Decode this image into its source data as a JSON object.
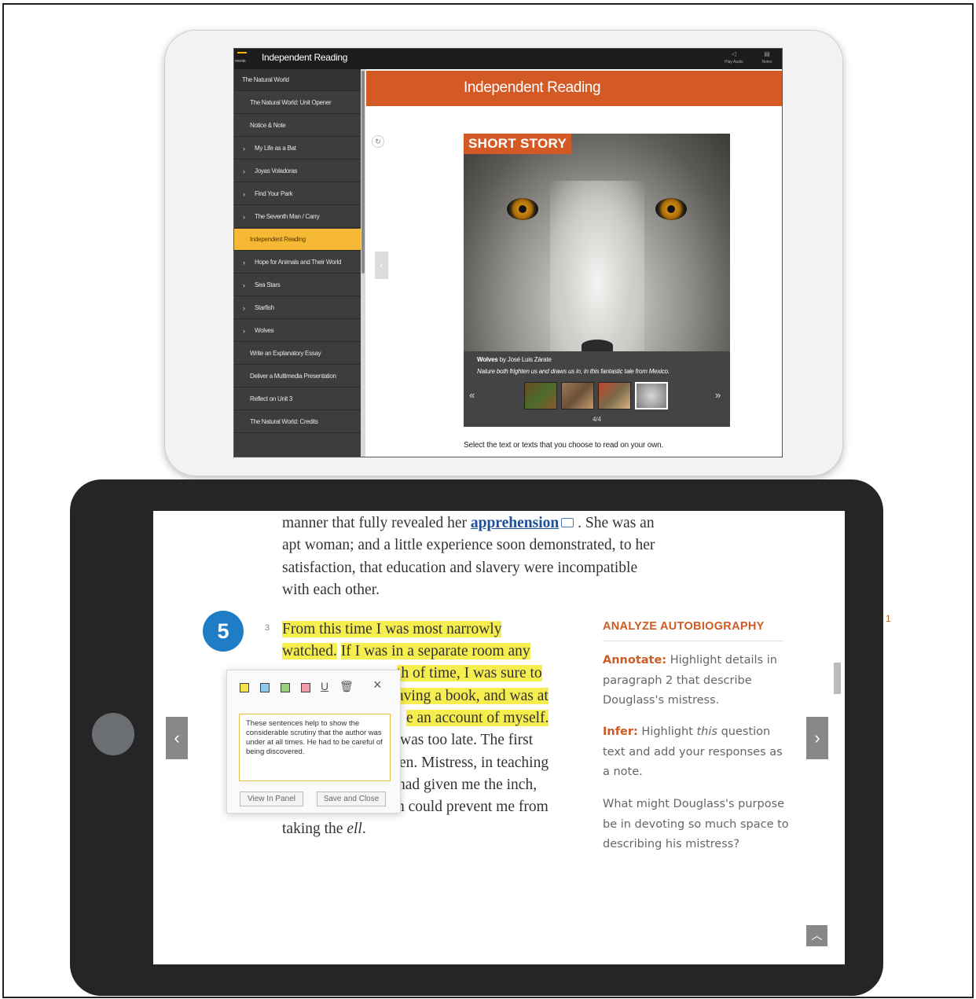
{
  "top_app": {
    "menu_label": "ments",
    "title": "Independent Reading",
    "toolbar": {
      "audio_label": "Play Audio",
      "notes_label": "Notes"
    },
    "sidebar_items": [
      {
        "label": "The Natural World"
      },
      {
        "label": "The Natural World: Unit Opener"
      },
      {
        "label": "Notice & Note"
      },
      {
        "label": "My Life as a Bat"
      },
      {
        "label": "Joyas Voladoras"
      },
      {
        "label": "Find Your Park"
      },
      {
        "label": "The Seventh Man / Carry"
      },
      {
        "label": "Independent Reading"
      },
      {
        "label": "Hope for Animals and Their World"
      },
      {
        "label": "Sea Stars"
      },
      {
        "label": "Starfish"
      },
      {
        "label": "Wolves"
      },
      {
        "label": "Write an Explanatory Essay"
      },
      {
        "label": "Deliver a Multimedia Presentation"
      },
      {
        "label": "Reflect on Unit 3"
      },
      {
        "label": "The Natural World: Credits"
      }
    ],
    "banner_title": "Independent Reading",
    "card": {
      "label": "SHORT STORY",
      "title_bold": "Wolves",
      "title_rest": " by José Luis Zárate",
      "description": "Nature both frighten us and draws us in, in this fantastic tale from Mexico.",
      "counter": "4/4",
      "prev_arrow": "«",
      "next_arrow": "»",
      "selected_index": 4
    },
    "instruction": "Select the text or texts that you choose to read on your own."
  },
  "reader": {
    "intro_lines": {
      "line1_a": "manner that fully revealed her ",
      "vocab_word": "apprehension",
      "line1_b": " . She was an",
      "line2": "apt woman; and a little experience soon demonstrated, to her",
      "line3": "satisfaction, that education and slavery were incompatible",
      "line4": "with each other."
    },
    "paragraph_badge": "5",
    "paragraph_number": "3",
    "para_lines": {
      "l1": "From this time I was most narrowly",
      "l2a": "watched.",
      "l2b": "If I was in a separate room any",
      "l3": "th of time, I was sure to",
      "l4": "aving a book, and was at",
      "l5": "e an account of myself.",
      "l6": "was too late. The first",
      "l7": "en. Mistress, in teaching",
      "l8": "had given me the inch,",
      "l9": "n could prevent me from",
      "l10a": "taking the ",
      "l10b": "ell",
      "l10c": "."
    },
    "side_panel": {
      "heading": "ANALYZE AUTOBIOGRAPHY",
      "annotate_label": "Annotate:",
      "annotate_text": [
        " Highlight details in",
        "paragraph 2 that describe",
        "Douglass's mistress."
      ],
      "infer_label": "Infer:",
      "infer_text_a": " Highlight ",
      "infer_text_em": "this",
      "infer_text_b": " question",
      "infer_lines": [
        "text and add your responses as",
        "a note."
      ],
      "question_lines": [
        "What might Douglass's purpose",
        "be in devoting so much space to",
        "describing his mistress?"
      ]
    },
    "annotation_popup": {
      "swatch_colors": [
        "#f6e14a",
        "#8ec8ec",
        "#9bd07a",
        "#f29aa7"
      ],
      "note_text": "These sentences help to show the considerable scrutiny that the author was under at all times. He had to be careful of being discovered.",
      "view_button": "View In Panel",
      "save_button": "Save and Close"
    },
    "nav": {
      "prev": "‹",
      "next": "›",
      "top": "︿"
    }
  }
}
